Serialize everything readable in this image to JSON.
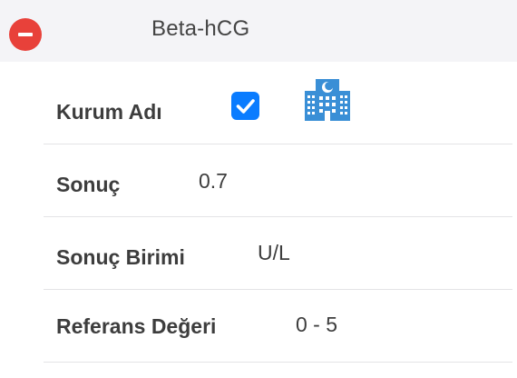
{
  "header": {
    "title": "Beta-hCG"
  },
  "fields": {
    "institution": {
      "label": "Kurum Adı",
      "checked": true,
      "icon": "hospital-icon"
    },
    "result": {
      "label": "Sonuç",
      "value": "0.7"
    },
    "unit": {
      "label": "Sonuç Birimi",
      "value": "U/L"
    },
    "reference": {
      "label": "Referans Değeri",
      "value": "0 - 5"
    }
  },
  "colors": {
    "remove": "#e8413a",
    "checkbox": "#0a7cff",
    "icon": "#3a8fd6",
    "header_bg": "#f4f4f7"
  }
}
